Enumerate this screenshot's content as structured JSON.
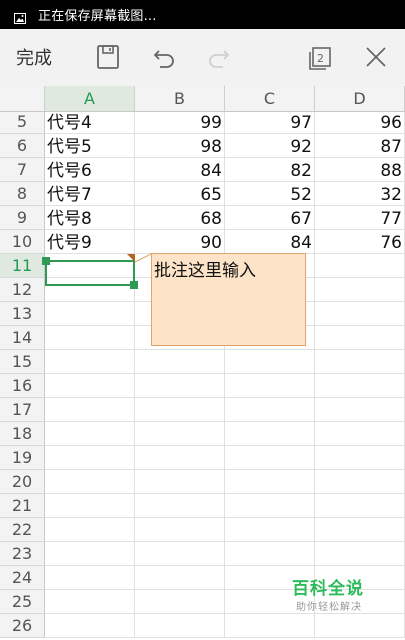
{
  "status_bar": {
    "text": "正在保存屏幕截图..."
  },
  "toolbar": {
    "done_label": "完成",
    "page_count": "2"
  },
  "columns": [
    "A",
    "B",
    "C",
    "D"
  ],
  "selected_column": "A",
  "rows": [
    {
      "n": "5",
      "a": "代号4",
      "b": "99",
      "c": "97",
      "d": "96"
    },
    {
      "n": "6",
      "a": "代号5",
      "b": "98",
      "c": "92",
      "d": "87"
    },
    {
      "n": "7",
      "a": "代号6",
      "b": "84",
      "c": "82",
      "d": "88"
    },
    {
      "n": "8",
      "a": "代号7",
      "b": "65",
      "c": "52",
      "d": "32"
    },
    {
      "n": "9",
      "a": "代号8",
      "b": "68",
      "c": "67",
      "d": "77"
    },
    {
      "n": "10",
      "a": "代号9",
      "b": "90",
      "c": "84",
      "d": "76"
    },
    {
      "n": "11",
      "a": "",
      "b": "",
      "c": "",
      "d": ""
    },
    {
      "n": "12",
      "a": "",
      "b": "",
      "c": "",
      "d": ""
    },
    {
      "n": "13",
      "a": "",
      "b": "",
      "c": "",
      "d": ""
    },
    {
      "n": "14",
      "a": "",
      "b": "",
      "c": "",
      "d": ""
    },
    {
      "n": "15",
      "a": "",
      "b": "",
      "c": "",
      "d": ""
    },
    {
      "n": "16",
      "a": "",
      "b": "",
      "c": "",
      "d": ""
    },
    {
      "n": "17",
      "a": "",
      "b": "",
      "c": "",
      "d": ""
    },
    {
      "n": "18",
      "a": "",
      "b": "",
      "c": "",
      "d": ""
    },
    {
      "n": "19",
      "a": "",
      "b": "",
      "c": "",
      "d": ""
    },
    {
      "n": "20",
      "a": "",
      "b": "",
      "c": "",
      "d": ""
    },
    {
      "n": "21",
      "a": "",
      "b": "",
      "c": "",
      "d": ""
    },
    {
      "n": "22",
      "a": "",
      "b": "",
      "c": "",
      "d": ""
    },
    {
      "n": "23",
      "a": "",
      "b": "",
      "c": "",
      "d": ""
    },
    {
      "n": "24",
      "a": "",
      "b": "",
      "c": "",
      "d": ""
    },
    {
      "n": "25",
      "a": "",
      "b": "",
      "c": "",
      "d": ""
    },
    {
      "n": "26",
      "a": "",
      "b": "",
      "c": "",
      "d": ""
    }
  ],
  "selected_row": "11",
  "comment": {
    "text": "批注这里输入"
  },
  "watermark": {
    "title": "百科全说",
    "subtitle": "助你轻松解决"
  },
  "colors": {
    "accent": "#2f9a53",
    "comment_bg": "#fde4c9",
    "comment_marker": "#b5651d"
  }
}
